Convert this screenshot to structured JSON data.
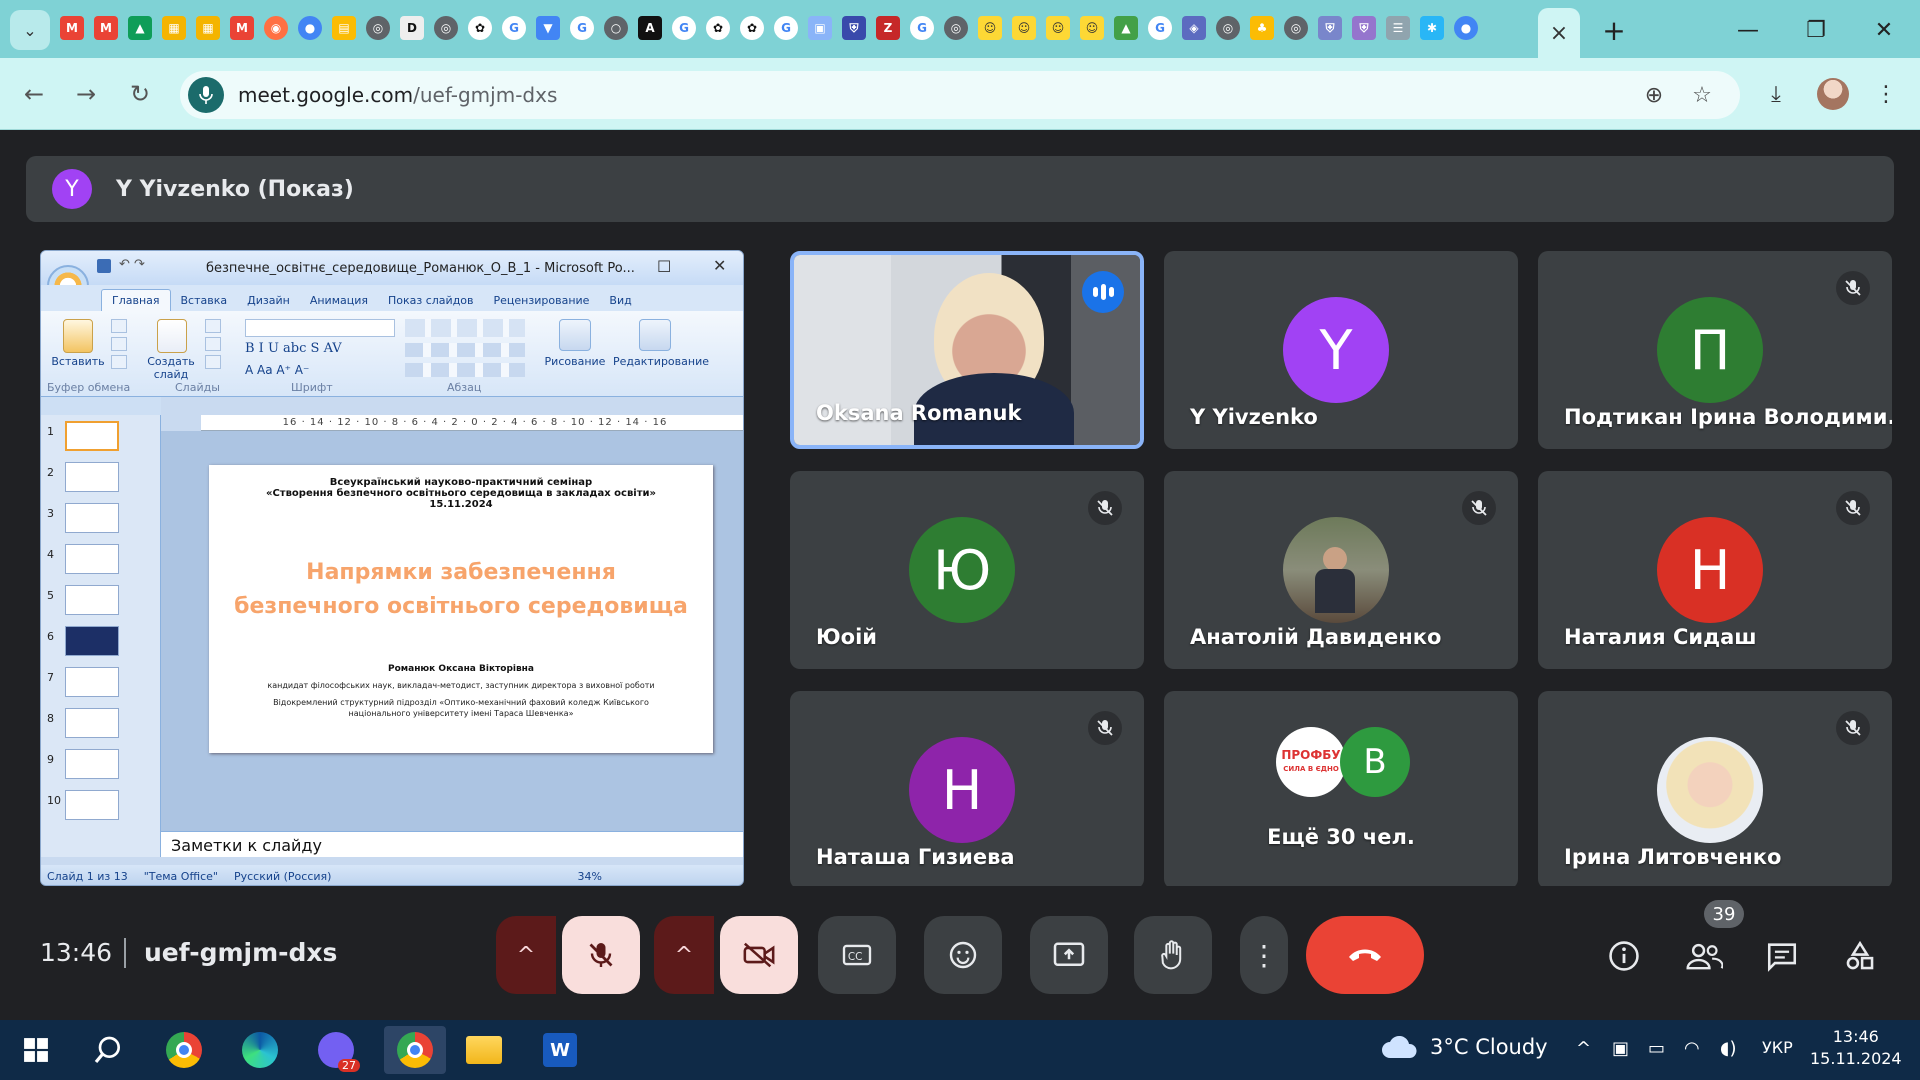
{
  "browser": {
    "url_host": "meet.google.com",
    "url_path": "/uef-gmjm-dxs",
    "tab_close": "×",
    "new_tab": "+"
  },
  "meet": {
    "presenter": {
      "initial": "Y",
      "label": "Y Yivzenko (Показ)"
    },
    "meeting_code": "uef-gmjm-dxs",
    "time": "13:46",
    "participant_count": "39",
    "tiles": [
      {
        "name": "Oksana Romanuk",
        "kind": "video",
        "speaking": true
      },
      {
        "name": "Y Yivzenko",
        "initial": "Y",
        "color": "#a142f4",
        "muted": false
      },
      {
        "name": "Подтикан Ірина Володими...",
        "initial": "П",
        "color": "#2e7d32",
        "muted": true
      },
      {
        "name": "Юоій",
        "initial": "Ю",
        "color": "#2e7d32",
        "muted": true
      },
      {
        "name": "Анатолій Давиденко",
        "kind": "photo",
        "muted": true
      },
      {
        "name": "Наталия Сидаш",
        "initial": "Н",
        "color": "#d93025",
        "muted": true
      },
      {
        "name": "Наташа Гизиева",
        "initial": "Н",
        "color": "#8e24aa",
        "muted": true
      },
      {
        "name": "Ещё 30 чел.",
        "badge1": "ПРОФБУ",
        "badge1_sub": "СИЛА В ЄДНО",
        "badge2": "В"
      },
      {
        "name": "Ірина Литовченко",
        "kind": "photo",
        "muted": true
      }
    ]
  },
  "ppt": {
    "window_title": "безпечне_освітнє_середовище_Романюк_О_В_1 - Microsoft Po...",
    "ribbon_tabs": [
      "Главная",
      "Вставка",
      "Дизайн",
      "Анимация",
      "Показ слайдов",
      "Рецензирование",
      "Вид"
    ],
    "groups": [
      "Буфер обмена",
      "Слайды",
      "Шрифт",
      "Абзац"
    ],
    "buttons": {
      "paste": "Вставить",
      "new_slide": "Создать слайд",
      "drawing": "Рисование",
      "editing": "Редактирование"
    },
    "ruler": "16 · 14 · 12 · 10 · 8 · 6 · 4 · 2 · 0 · 2 · 4 · 6 · 8 · 10 · 12 · 14 · 16",
    "thumb_numbers": [
      "1",
      "2",
      "3",
      "4",
      "5",
      "6",
      "7",
      "8",
      "9",
      "10"
    ],
    "slide": {
      "line1": "Всеукраїнський науково-практичний семінар",
      "line2": "«Створення безпечного освітнього середовища в закладах освіти»",
      "date": "15.11.2024",
      "title1": "Напрямки забезпечення",
      "title2": "безпечного освітнього середовища",
      "author": "Романюк Оксана Вікторівна",
      "role": "кандидат філософських наук, викладач-методист, заступник директора з виховної роботи",
      "org1": "Відокремлений структурний підрозділ «Оптико-механічний фаховий коледж Київського",
      "org2": "національного університету імені Тараса Шевченка»"
    },
    "notes": "Заметки к слайду",
    "status": {
      "slide": "Слайд 1 из 13",
      "theme": "\"Тема Office\"",
      "lang": "Русский (Россия)",
      "zoom": "34%"
    }
  },
  "taskbar": {
    "weather": "3°C  Cloudy",
    "lang": "УКР",
    "time": "13:46",
    "date": "15.11.2024",
    "viber_badge": "27"
  },
  "colors": {
    "accent": "#1a73e8",
    "end_call": "#ea4335",
    "tile_bg": "#3c4043",
    "page_bg": "#202124"
  }
}
